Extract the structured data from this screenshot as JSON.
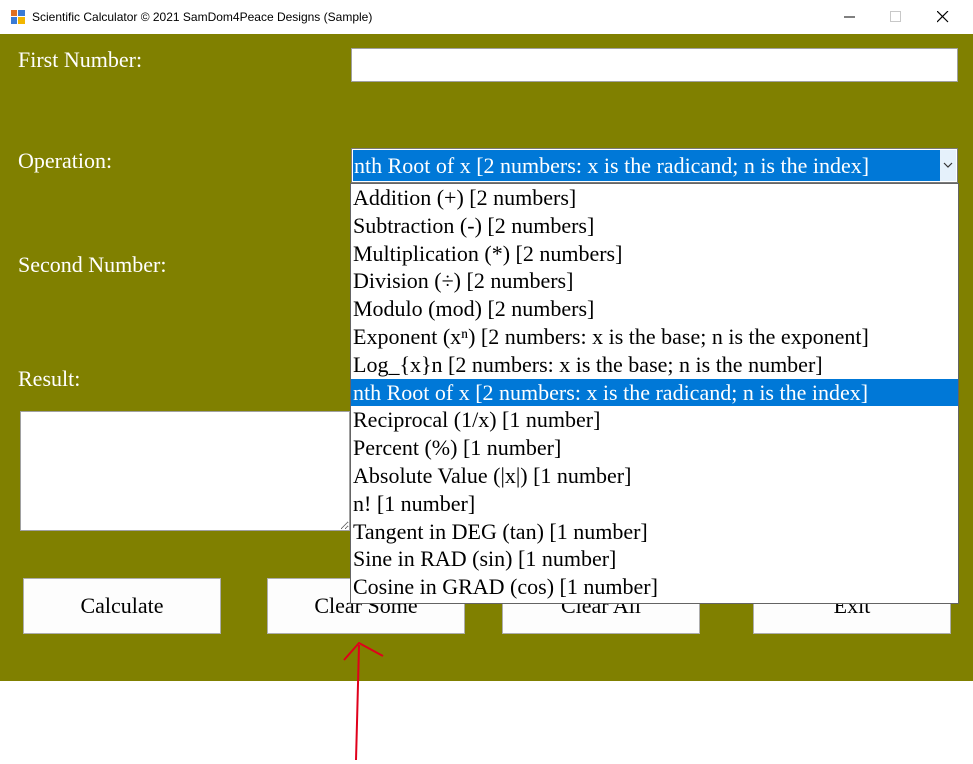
{
  "window": {
    "title": "Scientific Calculator © 2021 SamDom4Peace Designs (Sample)",
    "minimize_glyph": "—",
    "close_glyph": "✕"
  },
  "form": {
    "first_number_label": "First Number:",
    "first_number_value": "",
    "operation_label": "Operation:",
    "operation_selected": "nth Root of x [2 numbers: x is the radicand; n is the index]",
    "second_number_label": "Second Number:",
    "result_label": "Result:",
    "result_value": ""
  },
  "operations": [
    "Addition (+) [2 numbers]",
    "Subtraction (-) [2 numbers]",
    "Multiplication (*) [2 numbers]",
    "Division (÷) [2 numbers]",
    "Modulo (mod) [2 numbers]",
    "Exponent (xⁿ) [2 numbers: x is the base; n is the exponent]",
    "Log_{x}n [2 numbers: x is the base; n is the number]",
    "nth Root of x [2 numbers: x is the radicand; n is the index]",
    "Reciprocal (1/x) [1 number]",
    "Percent (%) [1 number]",
    "Absolute Value (|x|) [1 number]",
    "n! [1 number]",
    "Tangent in DEG (tan) [1 number]",
    "Sine in RAD (sin) [1 number]",
    "Cosine in GRAD (cos) [1 number]"
  ],
  "selected_index": 7,
  "buttons": {
    "calculate": "Calculate",
    "clear_some": "Clear Some",
    "clear_all": "Clear All",
    "exit": "Exit"
  },
  "colors": {
    "form_background": "#808000",
    "selection": "#0078d7",
    "annotation_arrow": "#e0001b"
  },
  "icons": {
    "app": "calculator-app-icon",
    "combo": "chevron-down-icon",
    "annotation": "red-arrow-annotation"
  }
}
